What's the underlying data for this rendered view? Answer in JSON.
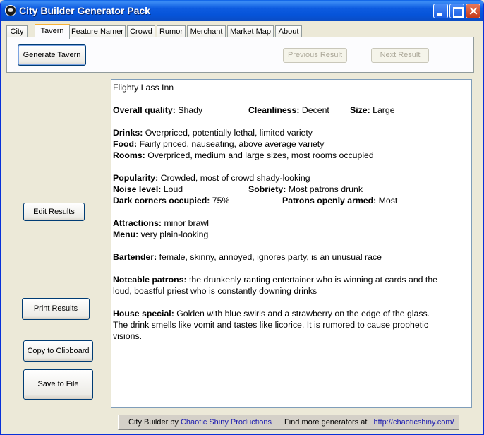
{
  "window": {
    "title": "City Builder Generator Pack"
  },
  "tabs": [
    "City",
    "Tavern",
    "Feature Namer",
    "Crowd",
    "Rumor",
    "Merchant",
    "Market Map",
    "About"
  ],
  "toolbar": {
    "generate_label": "Generate Tavern",
    "previous_label": "Previous Result",
    "next_label": "Next Result"
  },
  "side_buttons": {
    "edit_label": "Edit Results",
    "print_label": "Print Results",
    "copy_label": "Copy to Clipboard",
    "save_label": "Save to File"
  },
  "result": {
    "name": "Flighty Lass Inn",
    "quality_label": "Overall quality:",
    "quality": "Shady",
    "cleanliness_label": "Cleanliness:",
    "cleanliness": "Decent",
    "size_label": "Size:",
    "size": "Large",
    "drinks_label": "Drinks:",
    "drinks": "Overpriced, potentially lethal, limited variety",
    "food_label": "Food:",
    "food": "Fairly priced, nauseating, above average variety",
    "rooms_label": "Rooms:",
    "rooms": "Overpriced, medium and large sizes, most rooms occupied",
    "popularity_label": "Popularity:",
    "popularity": "Crowded, most of crowd shady-looking",
    "noise_label": "Noise level:",
    "noise": "Loud",
    "sobriety_label": "Sobriety:",
    "sobriety": "Most patrons drunk",
    "dark_label": "Dark corners occupied:",
    "dark": "75%",
    "armed_label": "Patrons openly armed:",
    "armed": "Most",
    "attractions_label": "Attractions:",
    "attractions": "minor brawl",
    "menu_label": "Menu:",
    "menu": "very plain-looking",
    "bartender_label": "Bartender:",
    "bartender": "female, skinny, annoyed, ignores party, is an unusual race",
    "patrons_label": "Noteable patrons:",
    "patrons_line1": "the drunkenly ranting entertainer who is winning at cards and the",
    "patrons_line2": "loud, boastful priest who is constantly downing drinks",
    "special_label": "House special:",
    "special_line1": "Golden with blue swirls and a strawberry on the edge of the glass.",
    "special_line2": "The drink smells like vomit and tastes like licorice. It is rumored to cause prophetic",
    "special_line3": "visions."
  },
  "footer": {
    "prefix": "City Builder by",
    "company": "Chaotic Shiny Productions",
    "more": "Find more generators at",
    "url": "http://chaoticshiny.com/"
  }
}
